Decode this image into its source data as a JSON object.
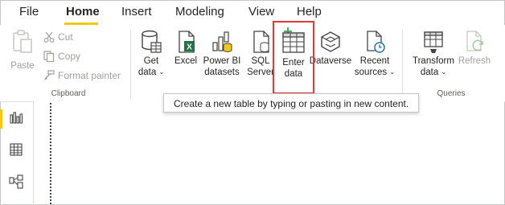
{
  "menu": {
    "tabs": [
      "File",
      "Home",
      "Insert",
      "Modeling",
      "View",
      "Help"
    ],
    "active": "Home"
  },
  "clipboard": {
    "paste": "Paste",
    "cut": "Cut",
    "copy": "Copy",
    "format_painter": "Format painter",
    "group_label": "Clipboard"
  },
  "data": {
    "get_data": [
      "Get",
      "data"
    ],
    "excel": "Excel",
    "power_bi_datasets": [
      "Power BI",
      "datasets"
    ],
    "sql_server": [
      "SQL",
      "Server"
    ],
    "enter_data": [
      "Enter",
      "data"
    ],
    "dataverse": "Dataverse",
    "recent_sources": [
      "Recent",
      "sources"
    ]
  },
  "queries": {
    "transform_data": [
      "Transform",
      "data"
    ],
    "refresh": "Refresh",
    "group_label": "Queries"
  },
  "tooltip": "Create a new table by typing or pasting in new content.",
  "colors": {
    "accent": "#f2c811",
    "highlight": "#e03a3a",
    "excel_green": "#217346",
    "enter_data_green": "#33a853"
  },
  "left_nav": [
    "report-view-icon",
    "table-view-icon",
    "model-view-icon"
  ]
}
